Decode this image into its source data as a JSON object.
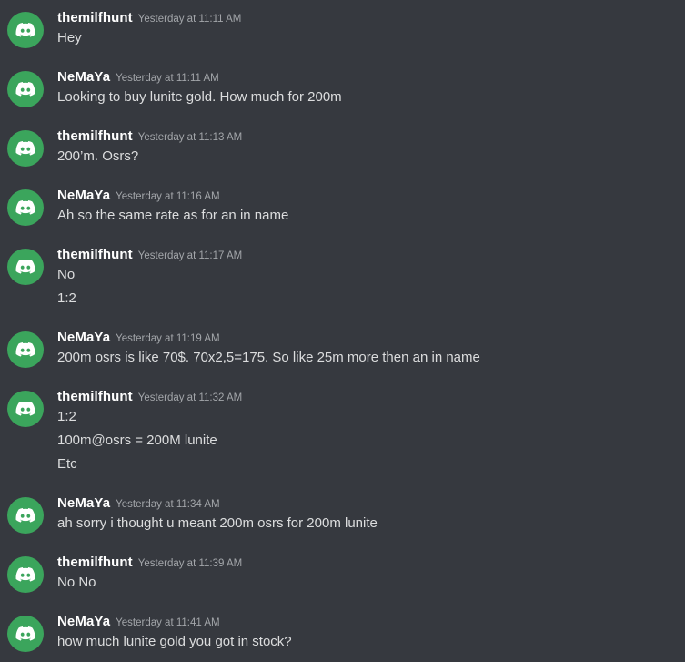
{
  "messages": [
    {
      "user": "themilfhunt",
      "time": "Yesterday at 11:11 AM",
      "lines": [
        "Hey"
      ]
    },
    {
      "user": "NeMaYa",
      "time": "Yesterday at 11:11 AM",
      "lines": [
        "Looking to buy lunite gold. How much for 200m"
      ]
    },
    {
      "user": "themilfhunt",
      "time": "Yesterday at 11:13 AM",
      "lines": [
        "200’m. Osrs?"
      ]
    },
    {
      "user": "NeMaYa",
      "time": "Yesterday at 11:16 AM",
      "lines": [
        "Ah so the same rate as for an in name"
      ]
    },
    {
      "user": "themilfhunt",
      "time": "Yesterday at 11:17 AM",
      "lines": [
        "No",
        "1:2"
      ]
    },
    {
      "user": "NeMaYa",
      "time": "Yesterday at 11:19 AM",
      "lines": [
        "200m osrs is like 70$. 70x2,5=175. So like 25m more then an in name"
      ]
    },
    {
      "user": "themilfhunt",
      "time": "Yesterday at 11:32 AM",
      "lines": [
        "1:2",
        "100m@osrs = 200M lunite",
        "Etc"
      ]
    },
    {
      "user": "NeMaYa",
      "time": "Yesterday at 11:34 AM",
      "lines": [
        "ah sorry i thought u meant 200m osrs for 200m lunite"
      ]
    },
    {
      "user": "themilfhunt",
      "time": "Yesterday at 11:39 AM",
      "lines": [
        "No No"
      ]
    },
    {
      "user": "NeMaYa",
      "time": "Yesterday at 11:41 AM",
      "lines": [
        "how much lunite gold you got in stock?"
      ]
    }
  ],
  "colors": {
    "background": "#36393f",
    "avatar": "#3ba55c",
    "username": "#ffffff",
    "timestamp": "#a3a6aa",
    "text": "#dcddde"
  },
  "icons": {
    "avatar": "discord-logo-icon"
  }
}
